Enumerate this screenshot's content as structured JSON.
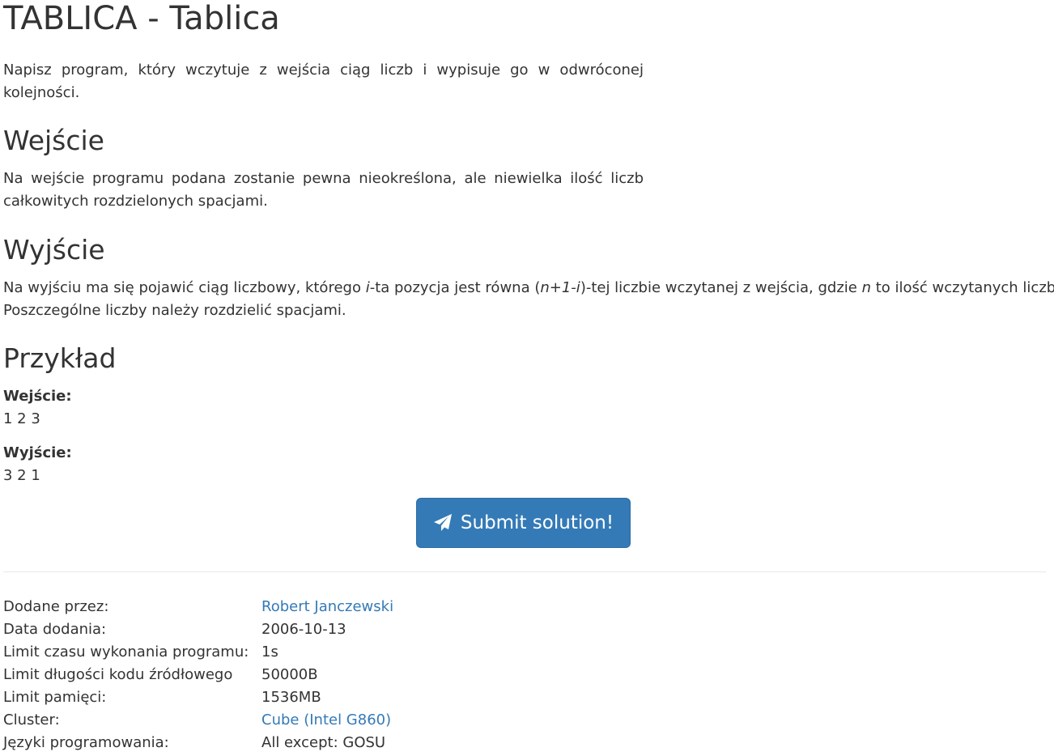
{
  "problem": {
    "title": "TABLICA - Tablica",
    "intro": "Napisz program, który wczytuje z wejścia ciąg liczb i wypisuje go w odwróconej kolejności.",
    "input_heading": "Wejście",
    "input_text": "Na wejście programu podana zostanie pewna nieokreślona, ale niewielka ilość liczb całkowitych rozdzielonych spacjami.",
    "output_heading": "Wyjście",
    "output_text": {
      "part1": "Na wyjściu ma się pojawić ciąg liczbowy, którego ",
      "i": "i",
      "part2": "-ta pozycja jest równa (",
      "expr": "n+1-i",
      "part3": ")-tej liczbie wczytanej z wejścia, gdzie ",
      "n": "n",
      "part4": " to ilość wczytanych liczb.",
      "line2": "Poszczególne liczby należy rozdzielić spacjami."
    },
    "example_heading": "Przykład",
    "example_input_label": "Wejście:",
    "example_input_value": "1 2 3",
    "example_output_label": "Wyjście:",
    "example_output_value": "3 2 1"
  },
  "submit": {
    "label": "Submit solution!",
    "icon": "paper-plane-icon",
    "color": "#337ab7"
  },
  "info": {
    "rows": [
      {
        "key": "Dodane przez:",
        "value": "Robert Janczewski",
        "link": true
      },
      {
        "key": "Data dodania:",
        "value": "2006-10-13",
        "link": false
      },
      {
        "key": "Limit czasu wykonania programu:",
        "value": "1s",
        "link": false
      },
      {
        "key": "Limit długości kodu źródłowego",
        "value": "50000B",
        "link": false
      },
      {
        "key": "Limit pamięci:",
        "value": "1536MB",
        "link": false
      },
      {
        "key": "Cluster:",
        "value": "Cube (Intel G860)",
        "link": true
      },
      {
        "key": "Języki programowania:",
        "value": "All except: GOSU",
        "link": false
      }
    ]
  },
  "colors": {
    "text": "#333333",
    "link": "#337ab7",
    "button": "#337ab7"
  }
}
